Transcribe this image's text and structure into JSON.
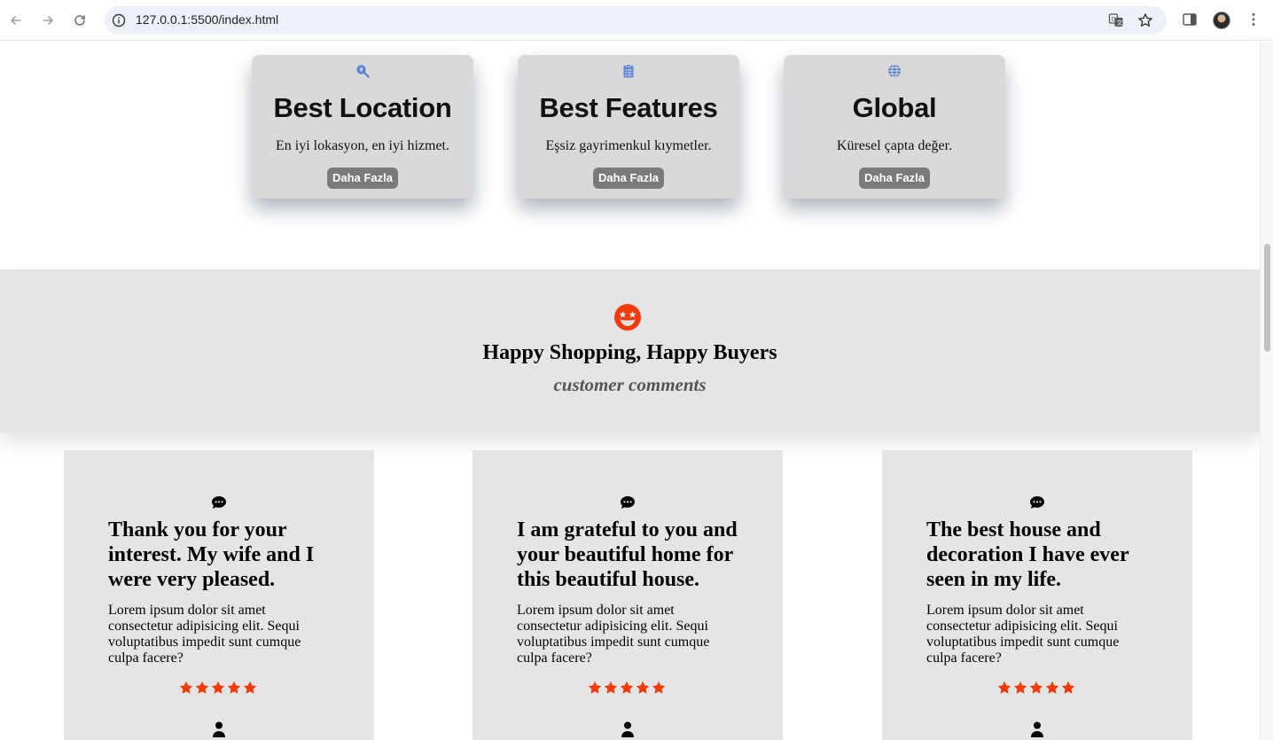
{
  "browser": {
    "url": "127.0.0.1:5500/index.html",
    "icons": [
      "back-icon",
      "forward-icon",
      "reload-icon",
      "site-info-icon",
      "translate-icon",
      "bookmark-star-icon",
      "side-panel-icon",
      "profile-avatar",
      "more-menu-icon"
    ]
  },
  "features": [
    {
      "icon": "search-location-icon",
      "title": "Best Location",
      "text": "En iyi lokasyon, en iyi hizmet.",
      "button": "Daha Fazla"
    },
    {
      "icon": "clipboard-list-icon",
      "title": "Best Features",
      "text": "Eşsiz gayrimenkul kıymetler.",
      "button": "Daha Fazla"
    },
    {
      "icon": "globe-icon",
      "title": "Global",
      "text": "Küresel çapta değer.",
      "button": "Daha Fazla"
    }
  ],
  "testimonials": {
    "icon": "grin-stars-icon",
    "title": "Happy Shopping, Happy Buyers",
    "subtitle": "customer comments",
    "accent_color": "#f23a0a",
    "comments": [
      {
        "heading": "Thank you for your interest. My wife and I were very pleased.",
        "body": "Lorem ipsum dolor sit amet consectetur adipisicing elit. Sequi voluptatibus impedit sunt cumque culpa facere?",
        "rating": 5
      },
      {
        "heading": "I am grateful to you and your beautiful home for this beautiful house.",
        "body": "Lorem ipsum dolor sit amet consectetur adipisicing elit. Sequi voluptatibus impedit sunt cumque culpa facere?",
        "rating": 5
      },
      {
        "heading": "The best house and decoration I have ever seen in my life.",
        "body": "Lorem ipsum dolor sit amet consectetur adipisicing elit. Sequi voluptatibus impedit sunt cumque culpa facere?",
        "rating": 5
      }
    ]
  }
}
